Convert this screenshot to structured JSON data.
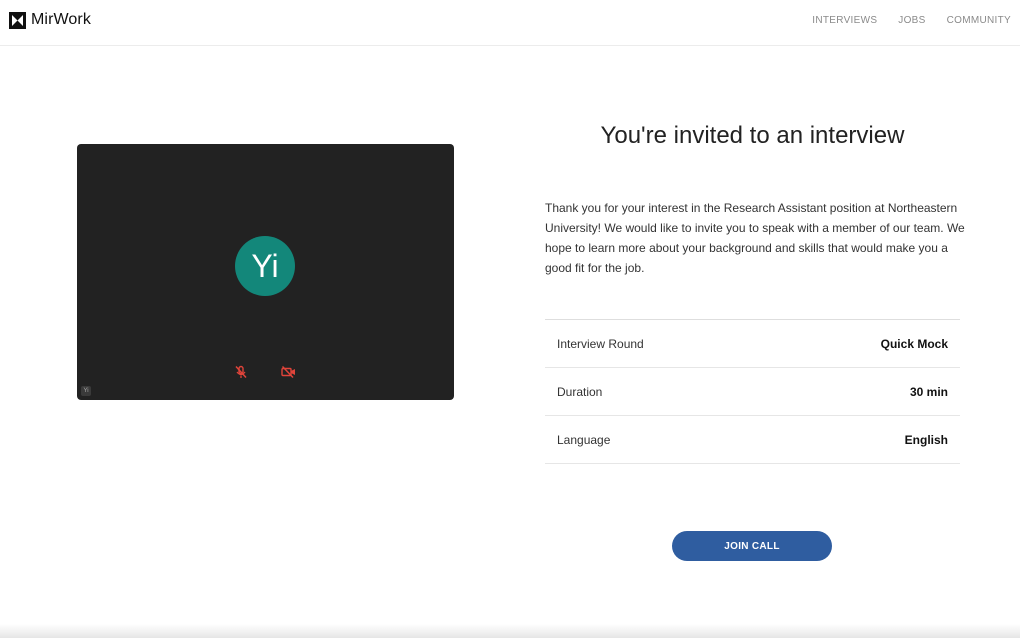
{
  "header": {
    "brand": "MirWork",
    "nav": [
      {
        "label": "INTERVIEWS"
      },
      {
        "label": "JOBS"
      },
      {
        "label": "COMMUNITY"
      }
    ]
  },
  "video": {
    "avatar_initials": "Yi",
    "avatar_color": "#13877a",
    "mic_icon": "mic-off-icon",
    "camera_icon": "camera-off-icon",
    "control_color": "#e0443a",
    "corner_badge": "Yi"
  },
  "invite": {
    "title": "You're invited to an interview",
    "description": "Thank you for your interest in the Research Assistant position at Northeastern University! We would like to invite you to speak with a member of our team. We hope to learn more about your background and skills that would make you a good fit for the job.",
    "details": [
      {
        "label": "Interview Round",
        "value": "Quick Mock"
      },
      {
        "label": "Duration",
        "value": "30 min"
      },
      {
        "label": "Language",
        "value": "English"
      }
    ],
    "join_label": "JOIN CALL",
    "accent_color": "#2f5da0"
  }
}
